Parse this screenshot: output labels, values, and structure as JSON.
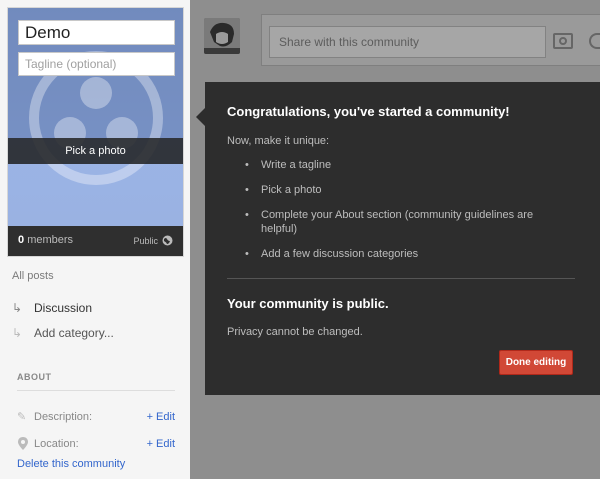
{
  "community": {
    "name": "Demo",
    "tagline_placeholder": "Tagline (optional)",
    "pick_photo": "Pick a photo",
    "member_count": "0",
    "members_label": "members",
    "visibility": "Public"
  },
  "nav": {
    "all_posts": "All posts",
    "items": [
      {
        "label": "Discussion"
      },
      {
        "label": "Add category..."
      }
    ]
  },
  "about": {
    "heading": "ABOUT",
    "rows": [
      {
        "label": "Description:",
        "edit": "+ Edit"
      },
      {
        "label": "Location:",
        "edit": "+ Edit"
      }
    ],
    "delete": "Delete this community"
  },
  "share": {
    "placeholder": "Share with this community"
  },
  "dialog": {
    "title": "Congratulations, you've started a community!",
    "subtitle": "Now, make it unique:",
    "items": [
      "Write a tagline",
      "Pick a photo",
      "Complete your About section (community guidelines are helpful)",
      "Add a few discussion categories"
    ],
    "public_title": "Your community is public.",
    "public_sub": "Privacy cannot be changed.",
    "done_label": "Done editing"
  },
  "icons": {
    "globe": "globe-icon",
    "pencil": "pencil-icon",
    "pin": "location-pin-icon",
    "camera": "camera-icon",
    "link": "link-icon",
    "arrow": "category-arrow-icon"
  },
  "colors": {
    "accent_red": "#d14836",
    "link_blue": "#3366cc",
    "dialog_bg": "#2d2d2d"
  }
}
